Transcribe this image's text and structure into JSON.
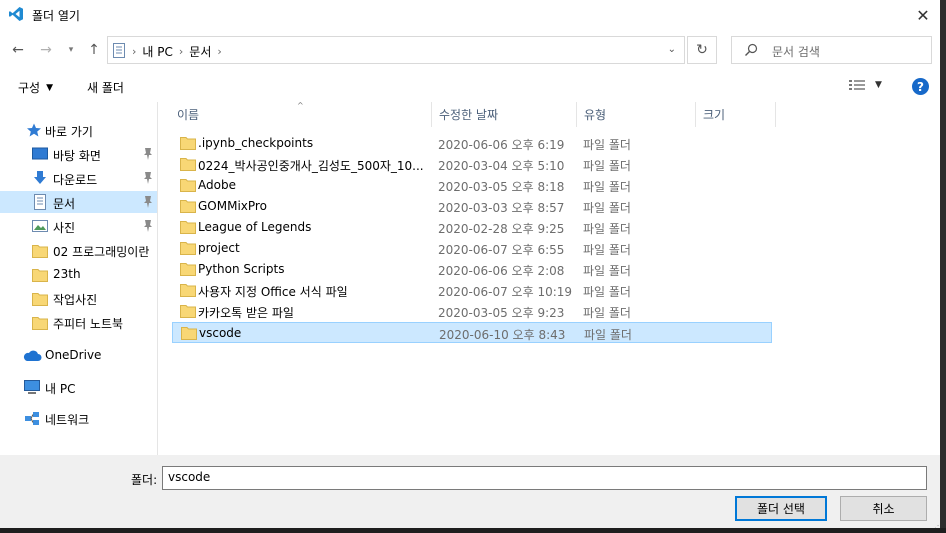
{
  "window": {
    "title": "폴더 열기"
  },
  "address": {
    "crumbs": [
      "내 PC",
      "문서"
    ]
  },
  "search": {
    "placeholder": "문서 검색"
  },
  "toolbar": {
    "organize_label": "구성",
    "new_folder_label": "새 폴더"
  },
  "nav": {
    "quick_access_label": "바로 가기",
    "items": [
      {
        "label": "바탕 화면",
        "icon": "desktop-icon",
        "pinned": true
      },
      {
        "label": "다운로드",
        "icon": "download-icon",
        "pinned": true
      },
      {
        "label": "문서",
        "icon": "document-icon",
        "pinned": true,
        "selected": true
      },
      {
        "label": "사진",
        "icon": "pictures-icon",
        "pinned": true
      },
      {
        "label": "02 프로그래밍이란",
        "icon": "folder-icon"
      },
      {
        "label": "23th",
        "icon": "folder-icon"
      },
      {
        "label": "작업사진",
        "icon": "folder-icon"
      },
      {
        "label": "주피터 노트북",
        "icon": "folder-icon"
      }
    ],
    "onedrive_label": "OneDrive",
    "thispc_label": "내 PC",
    "network_label": "네트워크"
  },
  "columns": {
    "name": "이름",
    "modified": "수정한 날짜",
    "type": "유형",
    "size": "크기"
  },
  "files": [
    {
      "name": ".ipynb_checkpoints",
      "modified": "2020-06-06 오후 6:19",
      "type": "파일 폴더"
    },
    {
      "name": "0224_박사공인중개사_김성도_500자_10...",
      "modified": "2020-03-04 오후 5:10",
      "type": "파일 폴더"
    },
    {
      "name": "Adobe",
      "modified": "2020-03-05 오후 8:18",
      "type": "파일 폴더"
    },
    {
      "name": "GOMMixPro",
      "modified": "2020-03-03 오후 8:57",
      "type": "파일 폴더"
    },
    {
      "name": "League of Legends",
      "modified": "2020-02-28 오후 9:25",
      "type": "파일 폴더"
    },
    {
      "name": "project",
      "modified": "2020-06-07 오후 6:55",
      "type": "파일 폴더"
    },
    {
      "name": "Python Scripts",
      "modified": "2020-06-06 오후 2:08",
      "type": "파일 폴더"
    },
    {
      "name": "사용자 지정 Office 서식 파일",
      "modified": "2020-06-07 오후 10:19",
      "type": "파일 폴더"
    },
    {
      "name": "카카오톡 받은 파일",
      "modified": "2020-03-05 오후 9:23",
      "type": "파일 폴더"
    },
    {
      "name": "vscode",
      "modified": "2020-06-10 오후 8:43",
      "type": "파일 폴더",
      "selected": true
    }
  ],
  "footer": {
    "folder_label": "폴더:",
    "folder_value": "vscode",
    "select_button": "폴더 선택",
    "cancel_button": "취소"
  },
  "colors": {
    "selection": "#cce8ff",
    "selection_border": "#99d1ff",
    "accent": "#0078d7",
    "folder": "#f8d775"
  }
}
